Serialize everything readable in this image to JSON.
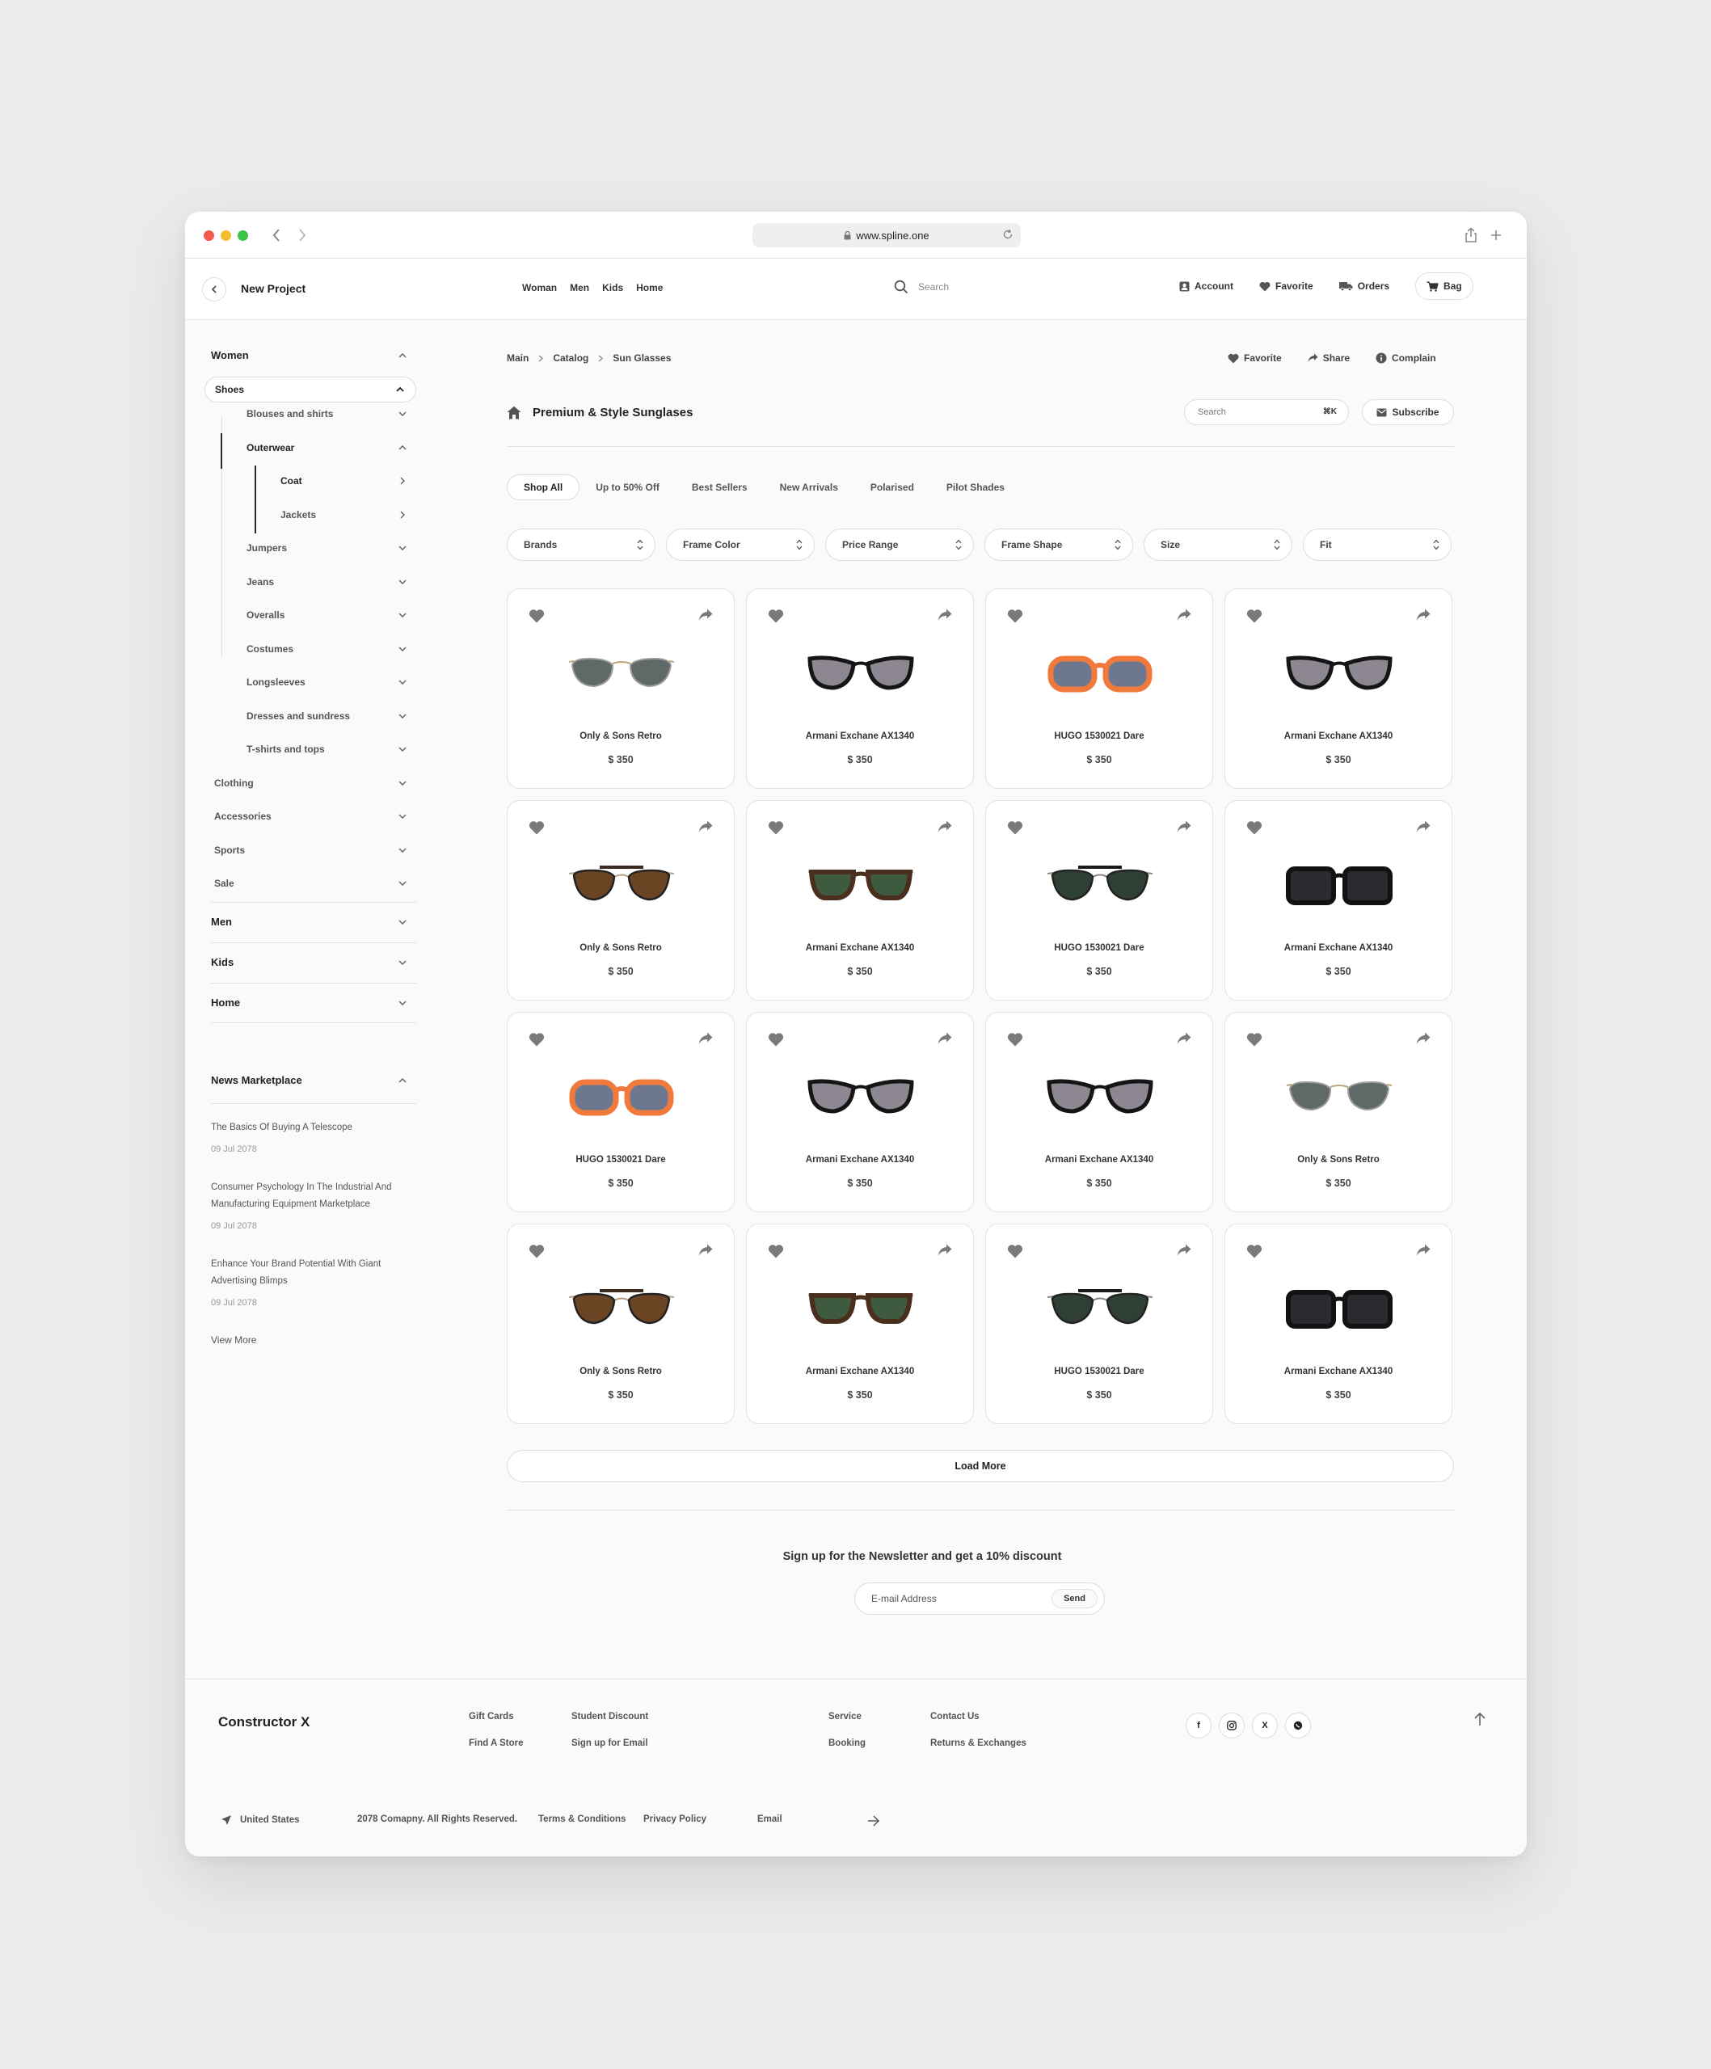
{
  "browser": {
    "url": "www.spline.one"
  },
  "header": {
    "project_title": "New Project",
    "nav": [
      "Woman",
      "Men",
      "Kids",
      "Home"
    ],
    "search_placeholder": "Search",
    "account": "Account",
    "favorite": "Favorite",
    "orders": "Orders",
    "bag": "Bag"
  },
  "sidebar": {
    "women": "Women",
    "shoes": "Shoes",
    "blouses": "Blouses and shirts",
    "outerwear": "Outerwear",
    "coat": "Coat",
    "jackets": "Jackets",
    "sub": [
      "Jumpers",
      "Jeans",
      "Overalls",
      "Costumes",
      "Longsleeves",
      "Dresses and sundress",
      "T-shirts and tops"
    ],
    "groups": [
      "Clothing",
      "Accessories",
      "Sports",
      "Sale"
    ],
    "men": "Men",
    "kids": "Kids",
    "home": "Home",
    "news_title": "News Marketplace",
    "news": [
      {
        "title": "The Basics Of Buying A Telescope",
        "date": "09 Jul 2078"
      },
      {
        "title": "Consumer Psychology In The Industrial And Manufacturing Equipment Marketplace",
        "date": "09 Jul 2078"
      },
      {
        "title": "Enhance Your Brand Potential With Giant Advertising Blimps",
        "date": "09 Jul 2078"
      }
    ],
    "view_more": "View More"
  },
  "main": {
    "breadcrumb": [
      "Main",
      "Catalog",
      "Sun Glasses"
    ],
    "actions": {
      "favorite": "Favorite",
      "share": "Share",
      "complain": "Complain"
    },
    "title": "Premium & Style Sunglases",
    "search_placeholder": "Search",
    "search_shortcut": "⌘K",
    "subscribe": "Subscribe",
    "tabs": [
      "Shop All",
      "Up to 50% Off",
      "Best Sellers",
      "New Arrivals",
      "Polarised",
      "Pilot Shades"
    ],
    "filters": [
      "Brands",
      "Frame Color",
      "Price Range",
      "Frame Shape",
      "Size",
      "Fit"
    ],
    "products": [
      {
        "name": "Only & Sons Retro",
        "price": "$ 350",
        "style": "grey-aviator"
      },
      {
        "name": "Armani Exchane AX1340",
        "price": "$ 350",
        "style": "black-cateye"
      },
      {
        "name": "HUGO 1530021 Dare",
        "price": "$ 350",
        "style": "orange-rect"
      },
      {
        "name": "Armani Exchane AX1340",
        "price": "$ 350",
        "style": "black-cateye"
      },
      {
        "name": "Only & Sons Retro",
        "price": "$ 350",
        "style": "brown-pilot"
      },
      {
        "name": "Armani Exchane AX1340",
        "price": "$ 350",
        "style": "tortoise-green"
      },
      {
        "name": "HUGO 1530021 Dare",
        "price": "$ 350",
        "style": "green-pilot"
      },
      {
        "name": "Armani Exchane AX1340",
        "price": "$ 350",
        "style": "black-square"
      },
      {
        "name": "HUGO 1530021 Dare",
        "price": "$ 350",
        "style": "orange-rect"
      },
      {
        "name": "Armani Exchane AX1340",
        "price": "$ 350",
        "style": "black-cateye"
      },
      {
        "name": "Armani Exchane AX1340",
        "price": "$ 350",
        "style": "black-cateye"
      },
      {
        "name": "Only & Sons Retro",
        "price": "$ 350",
        "style": "grey-aviator"
      },
      {
        "name": "Only & Sons Retro",
        "price": "$ 350",
        "style": "brown-pilot"
      },
      {
        "name": "Armani Exchane AX1340",
        "price": "$ 350",
        "style": "tortoise-green"
      },
      {
        "name": "HUGO 1530021 Dare",
        "price": "$ 350",
        "style": "green-pilot"
      },
      {
        "name": "Armani Exchane AX1340",
        "price": "$ 350",
        "style": "black-square"
      }
    ],
    "load_more": "Load More",
    "newsletter_title": "Sign up for the Newsletter and get a 10% discount",
    "email_placeholder": "E-mail Address",
    "send": "Send"
  },
  "footer": {
    "brand": "Constructor X",
    "col1": [
      "Gift Cards",
      "Find A Store"
    ],
    "col2": [
      "Student Discount",
      "Sign up for Email"
    ],
    "col3": [
      "Service",
      "Booking"
    ],
    "col4": [
      "Contact Us",
      "Returns & Exchanges"
    ],
    "social": [
      "f",
      "instagram-icon",
      "X",
      "whatsapp-icon"
    ],
    "country": "United States",
    "copyright": "2078 Comapny. All Rights Reserved.",
    "terms": "Terms & Conditions",
    "privacy": "Privacy Policy",
    "email_label": "Email"
  },
  "colors": {
    "accent": "#222222",
    "background": "#fafafa",
    "orange_frame": "#f07a3c"
  }
}
